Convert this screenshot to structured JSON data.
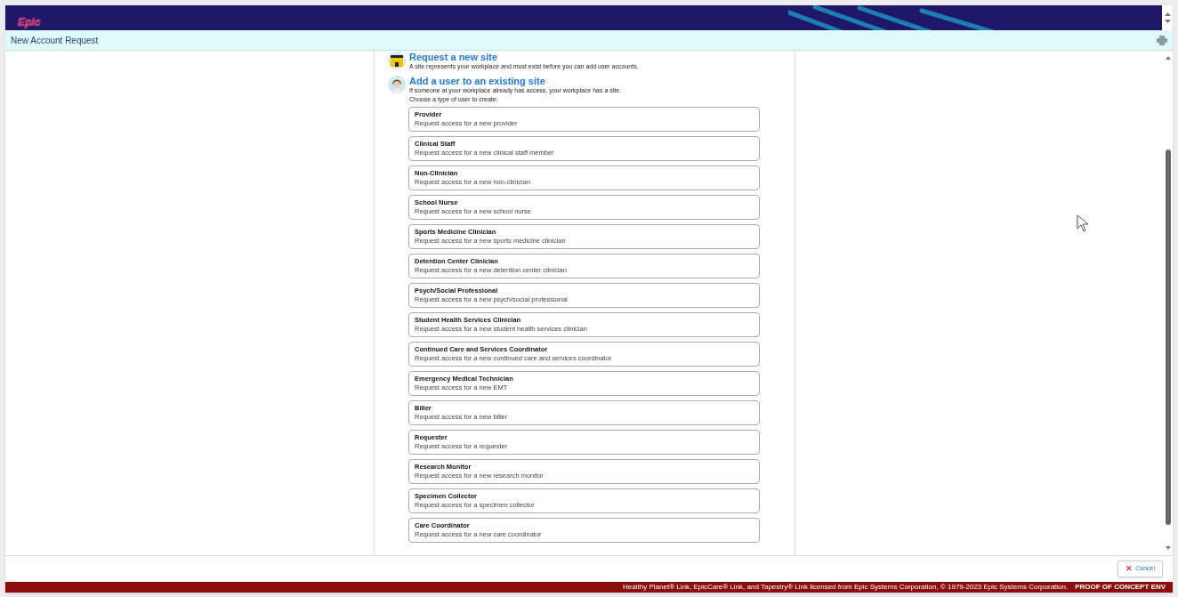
{
  "header": {
    "logo": "Epic"
  },
  "title_bar": {
    "title": "New Account Request"
  },
  "options": [
    {
      "kind": "site",
      "title": "Request a new site",
      "description": "A site represents your workplace and must exist before you can add user accounts."
    },
    {
      "kind": "user",
      "title": "Add a user to an existing site",
      "description": "If someone at your workplace already has access, your workplace has a site."
    }
  ],
  "prompt": "Choose a type of user to create:",
  "user_types": [
    {
      "title": "Provider",
      "description": "Request access for a new provider"
    },
    {
      "title": "Clinical Staff",
      "description": "Request access for a new clinical staff member"
    },
    {
      "title": "Non-Clinician",
      "description": "Request access for a new non-clinician"
    },
    {
      "title": "School Nurse",
      "description": "Request access for a new school nurse"
    },
    {
      "title": "Sports Medicine Clinician",
      "description": "Request access for a new sports medicine clinician"
    },
    {
      "title": "Detention Center Clinician",
      "description": "Request access for a new detention center clinician"
    },
    {
      "title": "Psych/Social Professional",
      "description": "Request access for a new psych/social professional"
    },
    {
      "title": "Student Health Services Clinician",
      "description": "Request access for a new student health services clinician"
    },
    {
      "title": "Continued Care and Services Coordinator",
      "description": "Request access for a new continued care and services coordinator"
    },
    {
      "title": "Emergency Medical Technician",
      "description": "Request access for a new EMT"
    },
    {
      "title": "Biller",
      "description": "Request access for a new biller"
    },
    {
      "title": "Requester",
      "description": "Request access for a requester"
    },
    {
      "title": "Research Monitor",
      "description": "Request access for a new research monitor"
    },
    {
      "title": "Specimen Collector",
      "description": "Request access for a specimen collector"
    },
    {
      "title": "Care Coordinator",
      "description": "Request access for a new care coordinator"
    }
  ],
  "cancel_button": {
    "icon": "✕",
    "label": "Cancel"
  },
  "footer": {
    "legal": "Healthy Planet® Link, EpicCare® Link, and Tapestry® Link licensed from Epic Systems Corporation, © 1979-2023 Epic Systems Corporation.",
    "environment": "PROOF OF CONCEPT ENV"
  }
}
